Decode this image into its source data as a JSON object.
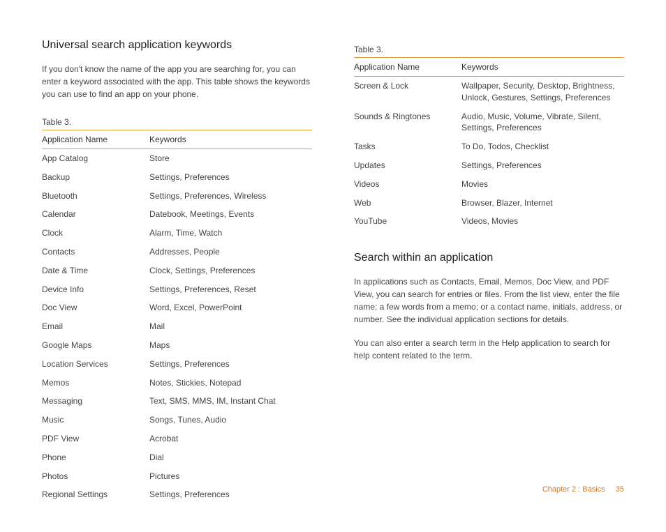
{
  "left": {
    "heading": "Universal search application keywords",
    "intro": "If you don't know the name of the app you are searching for, you can enter a keyword associated with the app. This table shows the keywords you can use to find an app on your phone.",
    "table_caption": "Table 3.",
    "table_header": {
      "col1": "Application Name",
      "col2": "Keywords"
    },
    "rows": [
      {
        "name": "App Catalog",
        "keywords": "Store"
      },
      {
        "name": "Backup",
        "keywords": "Settings, Preferences"
      },
      {
        "name": "Bluetooth",
        "keywords": "Settings, Preferences, Wireless"
      },
      {
        "name": "Calendar",
        "keywords": "Datebook, Meetings, Events"
      },
      {
        "name": "Clock",
        "keywords": "Alarm, Time, Watch"
      },
      {
        "name": "Contacts",
        "keywords": "Addresses, People"
      },
      {
        "name": "Date & Time",
        "keywords": "Clock, Settings, Preferences"
      },
      {
        "name": "Device Info",
        "keywords": "Settings, Preferences, Reset"
      },
      {
        "name": "Doc View",
        "keywords": "Word, Excel, PowerPoint"
      },
      {
        "name": "Email",
        "keywords": "Mail"
      },
      {
        "name": "Google Maps",
        "keywords": "Maps"
      },
      {
        "name": "Location Services",
        "keywords": "Settings, Preferences"
      },
      {
        "name": "Memos",
        "keywords": "Notes, Stickies, Notepad"
      },
      {
        "name": "Messaging",
        "keywords": "Text, SMS, MMS, IM, Instant Chat"
      },
      {
        "name": "Music",
        "keywords": "Songs, Tunes, Audio"
      },
      {
        "name": "PDF View",
        "keywords": "Acrobat"
      },
      {
        "name": "Phone",
        "keywords": "Dial"
      },
      {
        "name": "Photos",
        "keywords": "Pictures"
      },
      {
        "name": "Regional Settings",
        "keywords": "Settings, Preferences"
      }
    ]
  },
  "right": {
    "table_caption": "Table 3.",
    "table_header": {
      "col1": "Application Name",
      "col2": "Keywords"
    },
    "rows": [
      {
        "name": "Screen & Lock",
        "keywords": "Wallpaper, Security, Desktop, Brightness, Unlock, Gestures, Settings, Preferences"
      },
      {
        "name": "Sounds & Ringtones",
        "keywords": "Audio, Music, Volume, Vibrate, Silent, Settings, Preferences"
      },
      {
        "name": "Tasks",
        "keywords": "To Do, Todos, Checklist"
      },
      {
        "name": "Updates",
        "keywords": "Settings, Preferences"
      },
      {
        "name": "Videos",
        "keywords": "Movies"
      },
      {
        "name": "Web",
        "keywords": "Browser, Blazer, Internet"
      },
      {
        "name": "YouTube",
        "keywords": "Videos, Movies"
      }
    ],
    "heading2": "Search within an application",
    "para1": "In applications such as Contacts, Email, Memos, Doc View, and PDF View, you can search for entries or files. From the list view, enter the file name; a few words from a memo; or a contact name, initials, address, or number. See the individual application sections for details.",
    "para2": "You can also enter a search term in the Help application to search for help content related to the term."
  },
  "footer": {
    "chapter": "Chapter 2 : Basics",
    "page": "35"
  }
}
